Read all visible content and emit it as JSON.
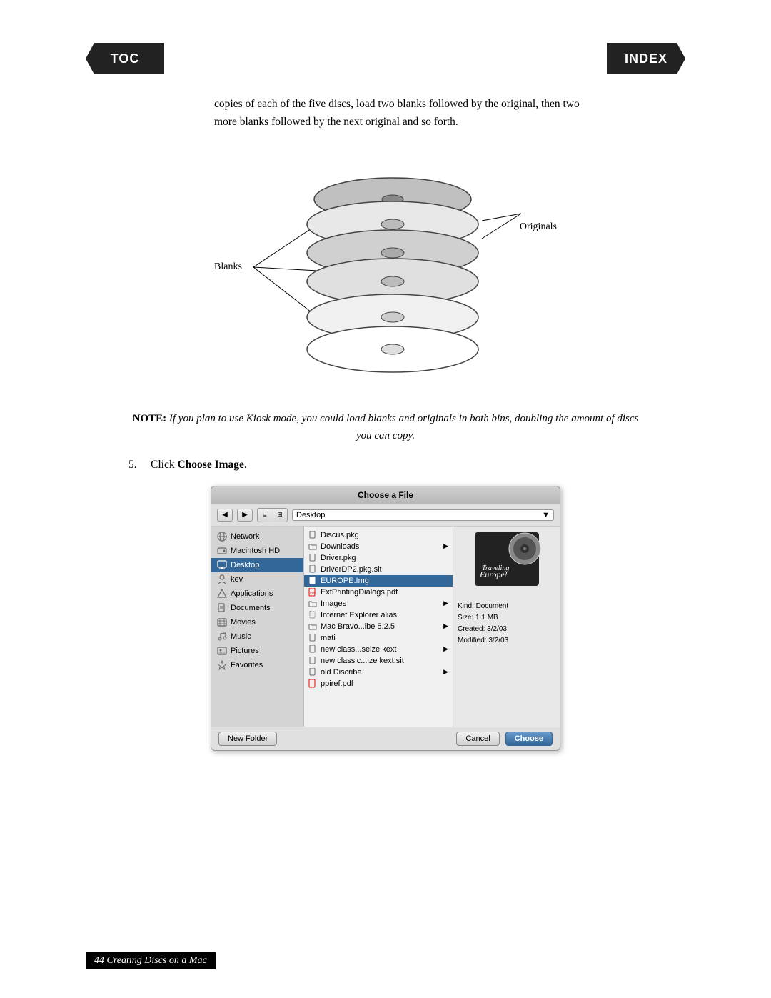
{
  "nav": {
    "toc_label": "TOC",
    "index_label": "INDEX"
  },
  "intro": {
    "text": "copies of each of the five discs, load two blanks followed by the original, then two more blanks followed by the next original and so forth."
  },
  "diagram": {
    "blanks_label": "Blanks",
    "originals_label": "Originals"
  },
  "note": {
    "label": "NOTE:",
    "text": "If you plan to use Kiosk mode, you could load blanks and originals in both bins, doubling the amount of discs you can copy."
  },
  "step5": {
    "number": "5.",
    "text": "Click ",
    "bold_text": "Choose Image",
    "period": "."
  },
  "dialog": {
    "title": "Choose a File",
    "location_label": "Desktop",
    "toolbar": {
      "back_label": "◀",
      "forward_label": "▶"
    },
    "sidebar_items": [
      {
        "label": "Network",
        "icon": "network"
      },
      {
        "label": "Macintosh HD",
        "icon": "harddrive"
      },
      {
        "label": "Desktop",
        "icon": "desktop",
        "selected": true
      },
      {
        "label": "kev",
        "icon": "folder"
      },
      {
        "label": "Applications",
        "icon": "apps"
      },
      {
        "label": "Documents",
        "icon": "documents"
      },
      {
        "label": "Movies",
        "icon": "movies"
      },
      {
        "label": "Music",
        "icon": "music"
      },
      {
        "label": "Pictures",
        "icon": "pictures"
      },
      {
        "label": "Favorites",
        "icon": "favorites"
      }
    ],
    "file_items": [
      {
        "label": "Discus.pkg",
        "icon": "file",
        "hasArrow": false
      },
      {
        "label": "Downloads",
        "icon": "folder",
        "hasArrow": true
      },
      {
        "label": "Driver.pkg",
        "icon": "file",
        "hasArrow": false
      },
      {
        "label": "DriverDP2.pkg.sit",
        "icon": "file",
        "hasArrow": false
      },
      {
        "label": "EUROPE.Img",
        "icon": "file",
        "selected": true,
        "hasArrow": false
      },
      {
        "label": "ExtPrintingDialogs.pdf",
        "icon": "pdf",
        "hasArrow": false
      },
      {
        "label": "Images",
        "icon": "folder",
        "hasArrow": true
      },
      {
        "label": "Internet Explorer alias",
        "icon": "alias",
        "hasArrow": false
      },
      {
        "label": "Mac Bravo...ibe 5.2.5",
        "icon": "folder",
        "hasArrow": true
      },
      {
        "label": "mati",
        "icon": "file",
        "hasArrow": false
      },
      {
        "label": "new class...seize kext",
        "icon": "file",
        "hasArrow": true
      },
      {
        "label": "new classic...ize kext.sit",
        "icon": "file",
        "hasArrow": false
      },
      {
        "label": "old Discribe",
        "icon": "file",
        "hasArrow": true
      },
      {
        "label": "ppiref.pdf",
        "icon": "pdf",
        "hasArrow": false
      }
    ],
    "info": {
      "kind_label": "Kind: Document",
      "size_label": "Size: 1.1 MB",
      "created_label": "Created: 3/2/03",
      "modified_label": "Modified: 3/2/03"
    },
    "buttons": {
      "new_folder": "New Folder",
      "cancel": "Cancel",
      "choose": "Choose"
    }
  },
  "footer": {
    "text": "44   Creating Discs on a Mac"
  }
}
